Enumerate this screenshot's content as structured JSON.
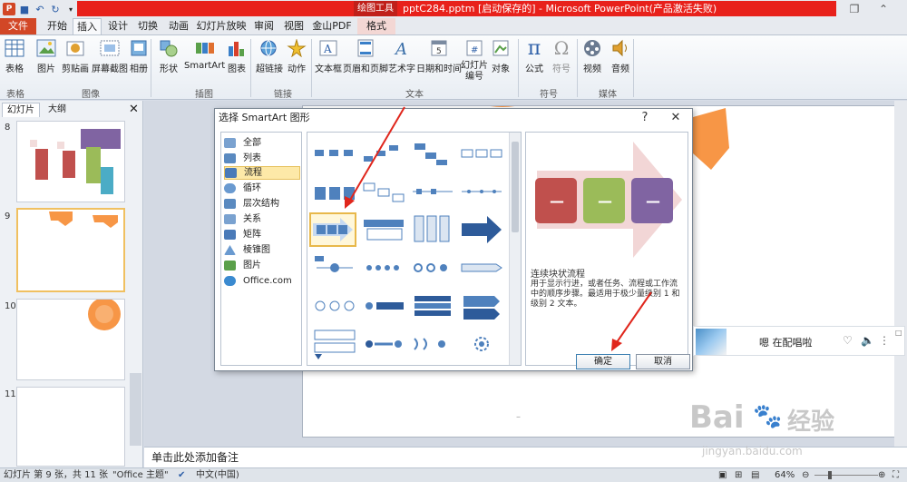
{
  "titlebar": {
    "context_tab": "绘图工具",
    "doc_title": "pptC284.pptm [启动保存的] - Microsoft PowerPoint(产品激活失败)",
    "qat_icons": [
      "powerpoint-app-icon",
      "save-icon",
      "undo-icon",
      "redo-icon",
      "customize-icon"
    ],
    "accent_color": "#e8211b"
  },
  "tabs": [
    "文件",
    "开始",
    "插入",
    "设计",
    "切换",
    "动画",
    "幻灯片放映",
    "审阅",
    "视图",
    "金山PDF",
    "格式"
  ],
  "ribbon": {
    "buttons": {
      "table": "表格",
      "picture": "图片",
      "clipart": "剪贴画",
      "screenshot": "屏幕截图",
      "album": "相册",
      "shapes": "形状",
      "smartart": "SmartArt",
      "chart": "图表",
      "hyperlink": "超链接",
      "action": "动作",
      "textbox": "文本框",
      "header_footer": "页眉和页脚",
      "wordart": "艺术字",
      "datetime": "日期和时间",
      "slidenum": "幻灯片编号",
      "object": "对象",
      "equation": "公式",
      "symbol": "符号",
      "video": "视频",
      "audio": "音频"
    },
    "groups": {
      "tables": "表格",
      "images": "图像",
      "illustrations": "插图",
      "links": "链接",
      "text": "文本",
      "symbols": "符号",
      "media": "媒体"
    }
  },
  "panel": {
    "tab_slides": "幻灯片",
    "tab_outline": "大纲",
    "slide_numbers": [
      "8",
      "9",
      "10",
      "11"
    ]
  },
  "notes_placeholder": "单击此处添加备注",
  "status": {
    "slide_info": "幻灯片 第 9 张，共 11 张",
    "theme": "\"Office 主题\"",
    "language": "中文(中国)",
    "zoom": "64%"
  },
  "dialog": {
    "title": "选择 SmartArt 图形",
    "help": "?",
    "close": "✕",
    "categories": [
      "全部",
      "列表",
      "流程",
      "循环",
      "层次结构",
      "关系",
      "矩阵",
      "棱锥图",
      "图片",
      "Office.com"
    ],
    "selected_category": "流程",
    "preview_title": "连续块状流程",
    "preview_desc": "用于显示行进，或者任务、流程或工作流中的顺序步骤。最适用于极少量级别 1 和级别 2 文本。",
    "preview_box_label": "—",
    "ok": "确定",
    "cancel": "取消"
  },
  "music": {
    "title": "嗯 在配唱啦"
  },
  "watermark": {
    "brand": "Bai",
    "brand_cn": "经验",
    "url": "jingyan.baidu.com"
  }
}
